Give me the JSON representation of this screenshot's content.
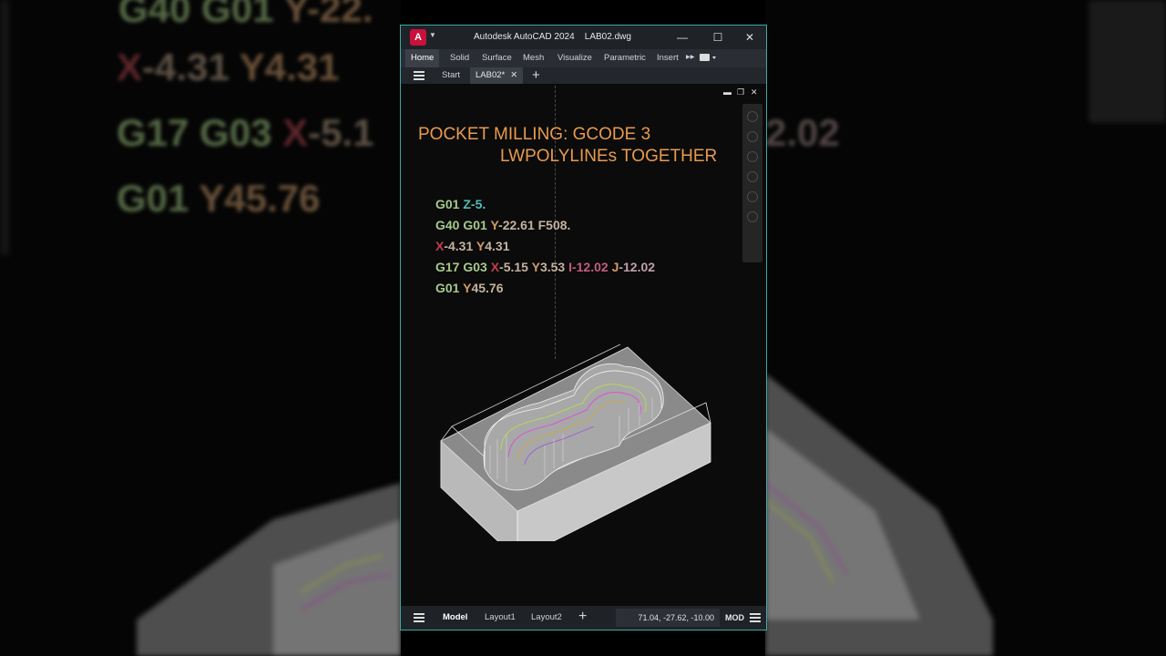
{
  "window": {
    "app_logo": "A",
    "title": "Autodesk AutoCAD 2024",
    "filename": "LAB02.dwg",
    "controls": {
      "minimize": "—",
      "maximize": "☐",
      "close": "✕"
    }
  },
  "ribbon": {
    "tabs": [
      "Home",
      "Solid",
      "Surface",
      "Mesh",
      "Visualize",
      "Parametric",
      "Insert"
    ],
    "more": "▸▸"
  },
  "file_tabs": {
    "start": "Start",
    "active": "LAB02*",
    "close": "✕",
    "add": "+"
  },
  "drawing": {
    "headline_line1": "POCKET MILLING: GCODE 3",
    "headline_line2": "LWPOLYLINEs TOGETHER",
    "gcode": [
      [
        {
          "t": "G01 ",
          "c": "key"
        },
        {
          "t": "Z",
          "c": "z"
        },
        {
          "t": "-5.",
          "c": "z"
        }
      ],
      [
        {
          "t": "G40 G01 ",
          "c": "key"
        },
        {
          "t": "Y",
          "c": "y"
        },
        {
          "t": "-22.61 ",
          "c": "v"
        },
        {
          "t": "F508.",
          "c": "v"
        }
      ],
      [
        {
          "t": "X",
          "c": "x"
        },
        {
          "t": "-4.31 ",
          "c": "v"
        },
        {
          "t": "Y",
          "c": "y"
        },
        {
          "t": "4.31",
          "c": "v"
        }
      ],
      [
        {
          "t": "G17 G03 ",
          "c": "key"
        },
        {
          "t": "X",
          "c": "x"
        },
        {
          "t": "-5.15 ",
          "c": "v"
        },
        {
          "t": "Y",
          "c": "y"
        },
        {
          "t": "3.53 ",
          "c": "v"
        },
        {
          "t": "I",
          "c": "ij"
        },
        {
          "t": "-12.02 ",
          "c": "ij"
        },
        {
          "t": "J",
          "c": "y"
        },
        {
          "t": "-12.02",
          "c": "j"
        }
      ],
      [
        {
          "t": "G01 ",
          "c": "key"
        },
        {
          "t": "Y",
          "c": "y"
        },
        {
          "t": "45.76",
          "c": "v"
        }
      ]
    ]
  },
  "viewport_controls": {
    "minimize": "▬",
    "restore": "❐",
    "close": "✕"
  },
  "status": {
    "model_tab": "Model",
    "layout1": "Layout1",
    "layout2": "Layout2",
    "add": "+",
    "coordinates": "71.04, -27.62, -10.00",
    "mode": "MOD"
  },
  "colors": {
    "accent_border": "#3aa9a6",
    "headline": "#e89a4f",
    "logo": "#c9113b"
  }
}
